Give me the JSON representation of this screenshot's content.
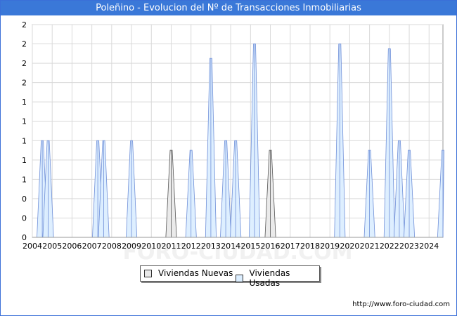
{
  "header": {
    "title": "Poleñino - Evolucion del Nº de Transacciones Inmobiliarias"
  },
  "footer": {
    "url": "http://www.foro-ciudad.com"
  },
  "watermark": "FORO-CIUDAD.COM",
  "legend": [
    {
      "label": "Viviendas Nuevas",
      "color": "#e9e9e9",
      "border": "#555555"
    },
    {
      "label": "Viviendas Usadas",
      "color": "#dceeff",
      "border": "#555555"
    }
  ],
  "chart_data": {
    "type": "area",
    "title": "Poleñino - Evolucion del Nº de Transacciones Inmobiliarias",
    "xlabel": "",
    "ylabel": "",
    "xlim": [
      2004,
      2024.7
    ],
    "ylim": [
      0,
      2.2
    ],
    "ytick_values": [
      0,
      0.2,
      0.4,
      0.6,
      0.8,
      1.0,
      1.2,
      1.4,
      1.6,
      1.8,
      2.0,
      2.2
    ],
    "ytick_labels": [
      "0",
      "0",
      "0",
      "1",
      "1",
      "1",
      "1",
      "1",
      "2",
      "2",
      "2",
      "2"
    ],
    "xtick_labels": [
      "2004",
      "2005",
      "2006",
      "2007",
      "2008",
      "2009",
      "2010",
      "2011",
      "2012",
      "2013",
      "2014",
      "2015",
      "2016",
      "2017",
      "2018",
      "2019",
      "2020",
      "2021",
      "2022",
      "2023",
      "2024"
    ],
    "grid": true,
    "legend_position": "bottom",
    "series": [
      {
        "name": "Viviendas Nuevas",
        "color": "#555555",
        "fill": "#e9e9e9",
        "peaks": [
          {
            "x": 2011.0,
            "y": 0.9
          },
          {
            "x": 2016.0,
            "y": 0.9
          }
        ]
      },
      {
        "name": "Viviendas Usadas",
        "color": "#6f8fd8",
        "fill": "#dceeff",
        "peaks": [
          {
            "x": 2004.5,
            "y": 1.0
          },
          {
            "x": 2004.8,
            "y": 1.0
          },
          {
            "x": 2007.3,
            "y": 1.0
          },
          {
            "x": 2007.6,
            "y": 1.0
          },
          {
            "x": 2009.0,
            "y": 1.0
          },
          {
            "x": 2012.0,
            "y": 0.9
          },
          {
            "x": 2013.0,
            "y": 1.85
          },
          {
            "x": 2013.75,
            "y": 1.0
          },
          {
            "x": 2014.25,
            "y": 1.0
          },
          {
            "x": 2015.2,
            "y": 2.0
          },
          {
            "x": 2019.5,
            "y": 2.0
          },
          {
            "x": 2021.0,
            "y": 0.9
          },
          {
            "x": 2022.0,
            "y": 1.95
          },
          {
            "x": 2022.5,
            "y": 1.0
          },
          {
            "x": 2023.0,
            "y": 0.9
          },
          {
            "x": 2024.7,
            "y": 0.9
          }
        ]
      }
    ]
  }
}
